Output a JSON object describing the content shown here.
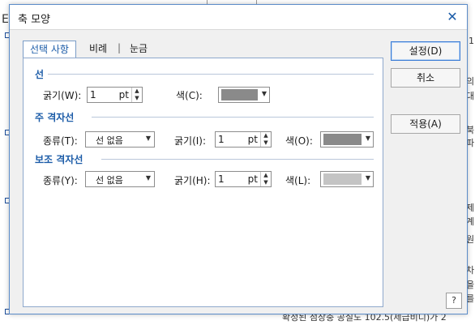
{
  "dialog": {
    "title": "축 모양",
    "close_glyph": "✕",
    "help_glyph": "?"
  },
  "tabs": [
    {
      "label": "선택 사항",
      "active": true
    },
    {
      "label": "비례",
      "active": false
    },
    {
      "label": "눈금",
      "active": false
    }
  ],
  "tab_separator": "|",
  "sections": {
    "line": {
      "title": "선",
      "thickness_label": "굵기(W):",
      "thickness_value": "1",
      "thickness_unit": "pt",
      "color_label": "색(C):",
      "color_value": "#8a8a8a"
    },
    "major_grid": {
      "title": "주 격자선",
      "type_label": "종류(T):",
      "type_value": "선 없음",
      "thickness_label": "굵기(I):",
      "thickness_value": "1",
      "thickness_unit": "pt",
      "color_label": "색(O):",
      "color_value": "#8a8a8a"
    },
    "minor_grid": {
      "title": "보조 격자선",
      "type_label": "종류(Y):",
      "type_value": "선 없음",
      "thickness_label": "굵기(H):",
      "thickness_value": "1",
      "thickness_unit": "pt",
      "color_label": "색(L):",
      "color_value": "#c4c4c4"
    }
  },
  "buttons": {
    "ok": "설정(D)",
    "cancel": "취소",
    "apply": "적용(A)"
  },
  "background": {
    "right_fragments": [
      "의",
      "대",
      "북",
      "파",
      "제",
      "계",
      "원",
      "차",
      "을",
      "를"
    ],
    "bottom_text": "확정된  점장충  공질도  102.5(제급비디)가 2",
    "top_left_fragment": "Ei",
    "top_right_fragment": "1"
  },
  "colors": {
    "accent": "#1c5ca8"
  }
}
